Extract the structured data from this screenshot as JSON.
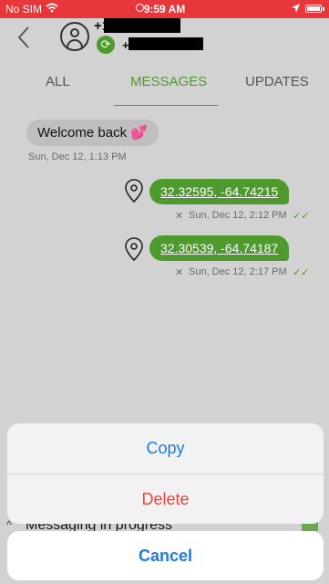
{
  "status_bar": {
    "carrier": "No SIM",
    "time": "9:59 AM"
  },
  "header": {
    "phone_prefix_1": "+1",
    "phone_prefix_2": "+"
  },
  "tabs": [
    {
      "label": "ALL"
    },
    {
      "label": "MESSAGES"
    },
    {
      "label": "UPDATES"
    }
  ],
  "messages": [
    {
      "text": "Welcome back 💕",
      "timestamp": "Sun, Dec 12, 1:13 PM"
    },
    {
      "text": "32.32595, -64.74215",
      "timestamp": "Sun, Dec 12, 2:12 PM"
    },
    {
      "text": "32.30539, -64.74187",
      "timestamp": "Sun, Dec 12, 2:17 PM"
    }
  ],
  "bottom_bar": {
    "label": "Messaging in progress"
  },
  "action_sheet": {
    "copy_label": "Copy",
    "delete_label": "Delete",
    "cancel_label": "Cancel"
  },
  "colors": {
    "status_bar": "#e8373a",
    "accent_green": "#4f9a2f",
    "ios_blue": "#1a7ae8",
    "destructive_red": "#e5463c"
  }
}
